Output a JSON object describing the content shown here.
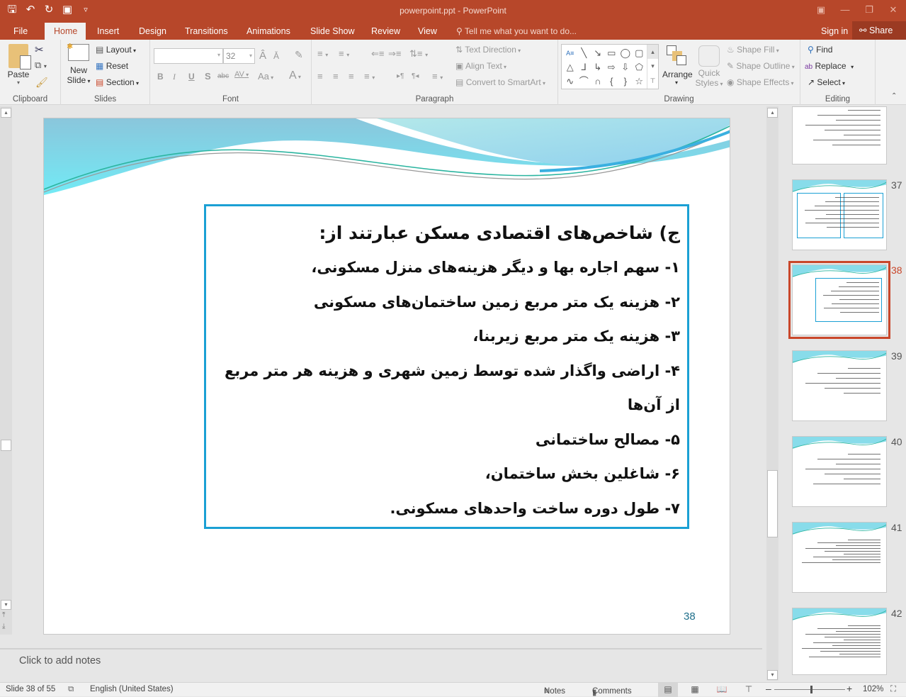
{
  "window": {
    "title": "powerpoint.ppt - PowerPoint",
    "qat": [
      {
        "name": "save-icon",
        "glyph": "🖫"
      },
      {
        "name": "undo-icon",
        "glyph": "↶▾"
      },
      {
        "name": "redo-icon",
        "glyph": "↻"
      },
      {
        "name": "start-from-beginning-icon",
        "glyph": "⛶"
      },
      {
        "name": "customize-qat-icon",
        "glyph": "₹"
      }
    ],
    "controls": {
      "ribbon_display": "▣",
      "minimize": "—",
      "restore": "❐",
      "close": "✕"
    }
  },
  "tabs": {
    "items": [
      "File",
      "Home",
      "Insert",
      "Design",
      "Transitions",
      "Animations",
      "Slide Show",
      "Review",
      "View"
    ],
    "active": "Home",
    "tell_me": "Tell me what you want to do...",
    "sign_in": "Sign in",
    "share": "Share"
  },
  "ribbon": {
    "clipboard": {
      "label": "Clipboard",
      "paste": "Paste"
    },
    "slides": {
      "label": "Slides",
      "new_slide_1": "New",
      "new_slide_2": "Slide",
      "layout": "Layout",
      "reset": "Reset",
      "section": "Section"
    },
    "font": {
      "label": "Font",
      "font_name": "",
      "font_size": "32",
      "bold": "B",
      "italic": "I",
      "underline": "U",
      "shadow": "S",
      "strike": "abc",
      "spacing": "AV",
      "case": "Aa",
      "color": "A"
    },
    "paragraph": {
      "label": "Paragraph",
      "text_direction": "Text Direction",
      "align_text": "Align Text",
      "convert_smartart": "Convert to SmartArt"
    },
    "drawing": {
      "label": "Drawing",
      "arrange": "Arrange",
      "quick_styles_1": "Quick",
      "quick_styles_2": "Styles",
      "shape_fill": "Shape Fill",
      "shape_outline": "Shape Outline",
      "shape_effects": "Shape Effects",
      "shapes": [
        "A≡",
        "╲",
        "↘",
        "▭",
        "◯",
        "▢",
        "△",
        "⅃",
        "↳",
        "⇨",
        "⇩",
        "⬠",
        "∿",
        "⌒",
        "∩",
        "{",
        "}",
        "☆"
      ]
    },
    "editing": {
      "label": "Editing",
      "find": "Find",
      "replace": "Replace",
      "select": "Select"
    }
  },
  "slide": {
    "heading": "ج) شاخص‌های اقتصادی مسکن عبارتند از:",
    "items": [
      "۱- سهم اجاره بها و دیگر هزینه‌های منزل مسکونی،",
      "۲- هزینه یک متر مربع زمین ساختمان‌های مسکونی",
      "۳- هزینه یک متر مربع زیربنا،",
      "۴- اراضی واگذار شده توسط زمین شهری و هزینه هر متر مربع از آن‌ها",
      "۵- مصالح ساختمانی",
      "۶- شاغلین بخش ساختمان،",
      "۷- طول دوره ساخت واحدهای مسکونی."
    ],
    "number": "38",
    "accent_color": "#1ba0d4"
  },
  "notes": {
    "placeholder": "Click to add notes"
  },
  "thumbnails": [
    {
      "number": "",
      "selected": false
    },
    {
      "number": "37",
      "selected": false
    },
    {
      "number": "38",
      "selected": true
    },
    {
      "number": "39",
      "selected": false
    },
    {
      "number": "40",
      "selected": false
    },
    {
      "number": "41",
      "selected": false
    },
    {
      "number": "42",
      "selected": false
    }
  ],
  "statusbar": {
    "slide_info": "Slide 38 of 55",
    "language": "English (United States)",
    "notes": "Notes",
    "comments": "Comments",
    "zoom": "102%",
    "zoom_level": 1.02
  }
}
